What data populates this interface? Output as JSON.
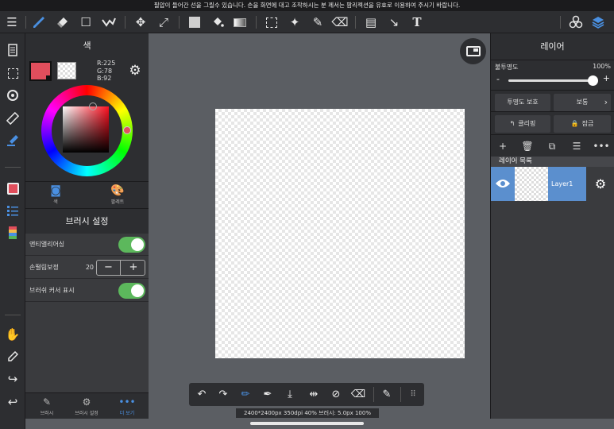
{
  "notice": "필압이 들어간 선을 그릴수 있습니다. 손을 화면에 대고 조작하시는 분 께서는 팜리젝션을 유효로 이용하여 주시기 바랍니다.",
  "icons": {
    "menu": "☰",
    "brush": "🖌",
    "eraser": "◆",
    "rect": "☐",
    "select_tool": "✔",
    "move": "✥",
    "transform": "⤢",
    "fill_color": "■",
    "bucket": "◍",
    "gradient": "▭",
    "marquee": "⬚",
    "magic_wand": "✦",
    "select_pen": "✎",
    "select_eraser": "⌫",
    "comic": "▤",
    "select_move": "↘",
    "text": "T",
    "materials": "⬢",
    "layers": "❖"
  },
  "color_panel": {
    "title": "색",
    "rgb": {
      "r": "R:225",
      "g": "G:78",
      "b": "B:92"
    },
    "main_color": "#e14e5c",
    "tabs": [
      {
        "label": "색"
      },
      {
        "label": "팔레트"
      }
    ]
  },
  "brush_settings": {
    "title": "브러시 설정",
    "antialias_label": "앤티앨리어싱",
    "stabilizer_label": "손떨림보정",
    "stabilizer_value": "20",
    "cursor_label": "브러쉬 커서 표시"
  },
  "panel_bottom": {
    "tabs": [
      {
        "label": "브러시"
      },
      {
        "label": "브러시 설정"
      },
      {
        "label": "더 보기"
      }
    ]
  },
  "status": "2400*2400px 350dpi 40% 브러시: 5.0px 100%",
  "layer_panel": {
    "title": "레이어",
    "opacity_label": "불투명도",
    "opacity_value": "100%",
    "opacity_fraction": 1.0,
    "protect_alpha": "투명도 보호",
    "blend_mode": "보통",
    "clipping": "클리핑",
    "lock": "잠금",
    "list_header": "레이어 목록",
    "layers": [
      {
        "name": "Layer1"
      }
    ]
  }
}
